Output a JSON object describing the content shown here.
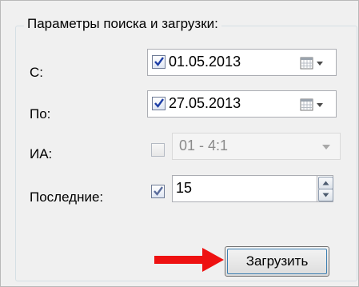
{
  "group": {
    "title": "Параметры поиска и загрузки:"
  },
  "from": {
    "label": "С:",
    "checked": true,
    "value": "01.05.2013"
  },
  "to": {
    "label": "По:",
    "checked": true,
    "value": "27.05.2013"
  },
  "ia": {
    "label": "ИА:",
    "checked": false,
    "enabled": false,
    "value": "01 - 4:1"
  },
  "last": {
    "label": "Последние:",
    "checked": true,
    "value": "15"
  },
  "load_button": {
    "label": "Загрузить"
  },
  "colors": {
    "arrow": "#ee1111",
    "check": "#1d3ea6",
    "disabled_text": "#8a8a8a"
  },
  "icons": {
    "calendar": "calendar-dropdown-icon",
    "combo": "chevron-down-icon",
    "spin": "spin-arrows-icon",
    "arrow": "arrow-right-icon"
  }
}
